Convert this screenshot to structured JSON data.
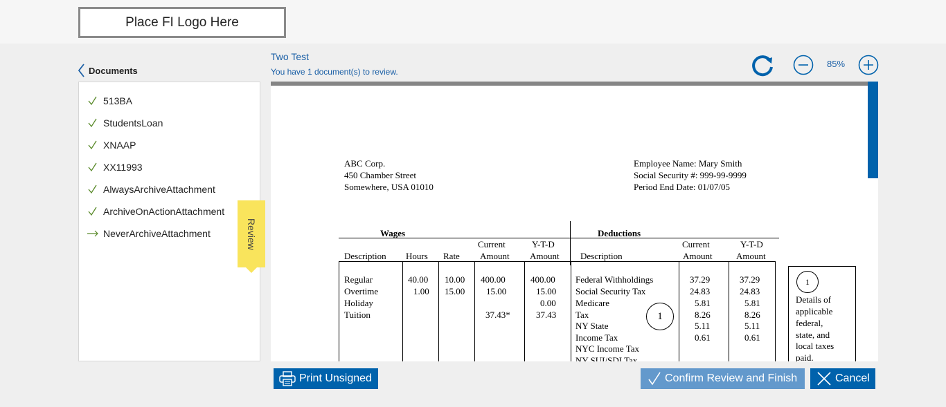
{
  "header": {
    "logo_text": "Place FI Logo Here"
  },
  "sidebar": {
    "title": "Documents",
    "items": [
      {
        "label": "513BA",
        "status": "check"
      },
      {
        "label": "StudentsLoan",
        "status": "check"
      },
      {
        "label": "XNAAP",
        "status": "check"
      },
      {
        "label": "XX11993",
        "status": "check"
      },
      {
        "label": "AlwaysArchiveAttachment",
        "status": "check"
      },
      {
        "label": "ArchiveOnActionAttachment",
        "status": "check"
      },
      {
        "label": "NeverArchiveAttachment",
        "status": "arrow"
      }
    ],
    "review_tab": "Review"
  },
  "document": {
    "title": "Two Test",
    "subtitle": "You have 1 document(s) to review.",
    "zoom": "85%"
  },
  "paystub": {
    "company": [
      "ABC Corp.",
      "450 Chamber Street",
      "Somewhere, USA 01010"
    ],
    "employee": [
      "Employee Name: Mary Smith",
      "Social Security #: 999-99-9999",
      "Period End Date: 01/07/05"
    ],
    "wages_heading": "Wages",
    "deductions_heading": "Deductions",
    "wage_headers": {
      "description": "Description",
      "hours": "Hours",
      "rate": "Rate",
      "current_top": "Current",
      "current_bottom": "Amount",
      "ytd_top": "Y-T-D",
      "ytd_bottom": "Amount"
    },
    "ded_headers": {
      "description": "Description",
      "current_top": "Current",
      "current_bottom": "Amount",
      "ytd_top": "Y-T-D",
      "ytd_bottom": "Amount"
    },
    "wage_rows": [
      {
        "desc": "Regular",
        "hours": "40.00",
        "rate": "10.00",
        "current": "400.00",
        "ytd": "400.00"
      },
      {
        "desc": "Overtime",
        "hours": "1.00",
        "rate": "15.00",
        "current": "15.00",
        "ytd": "15.00"
      },
      {
        "desc": "Holiday",
        "hours": "",
        "rate": "",
        "current": "",
        "ytd": "0.00"
      },
      {
        "desc": "Tuition",
        "hours": "",
        "rate": "",
        "current": "37.43*",
        "ytd": "37.43"
      }
    ],
    "ded_rows": [
      {
        "desc": "Federal Withholdings",
        "current": "37.29",
        "ytd": "37.29"
      },
      {
        "desc": "Social Security Tax",
        "current": "24.83",
        "ytd": "24.83"
      },
      {
        "desc": "Medicare",
        "current": "5.81",
        "ytd": "5.81"
      },
      {
        "desc": "Tax",
        "current": "8.26",
        "ytd": "8.26"
      },
      {
        "desc": "NY State",
        "current": "5.11",
        "ytd": "5.11"
      },
      {
        "desc": "Income Tax",
        "current": "0.61",
        "ytd": "0.61"
      },
      {
        "desc": "NYC Income Tax",
        "current": "",
        "ytd": ""
      },
      {
        "desc": "NY SUI/SDI Tax",
        "current": "",
        "ytd": ""
      }
    ],
    "callout_marker": "1",
    "note_marker": "1",
    "note_lines": [
      "Details of",
      "applicable",
      "federal,",
      "state, and",
      "local taxes",
      "paid."
    ]
  },
  "actions": {
    "print": "Print Unsigned",
    "confirm": "Confirm Review and Finish",
    "cancel": "Cancel"
  },
  "colors": {
    "accent": "#0062ac",
    "confirm": "#6399cc",
    "review_tab": "#f9e45c",
    "check": "#5a8a2a"
  }
}
